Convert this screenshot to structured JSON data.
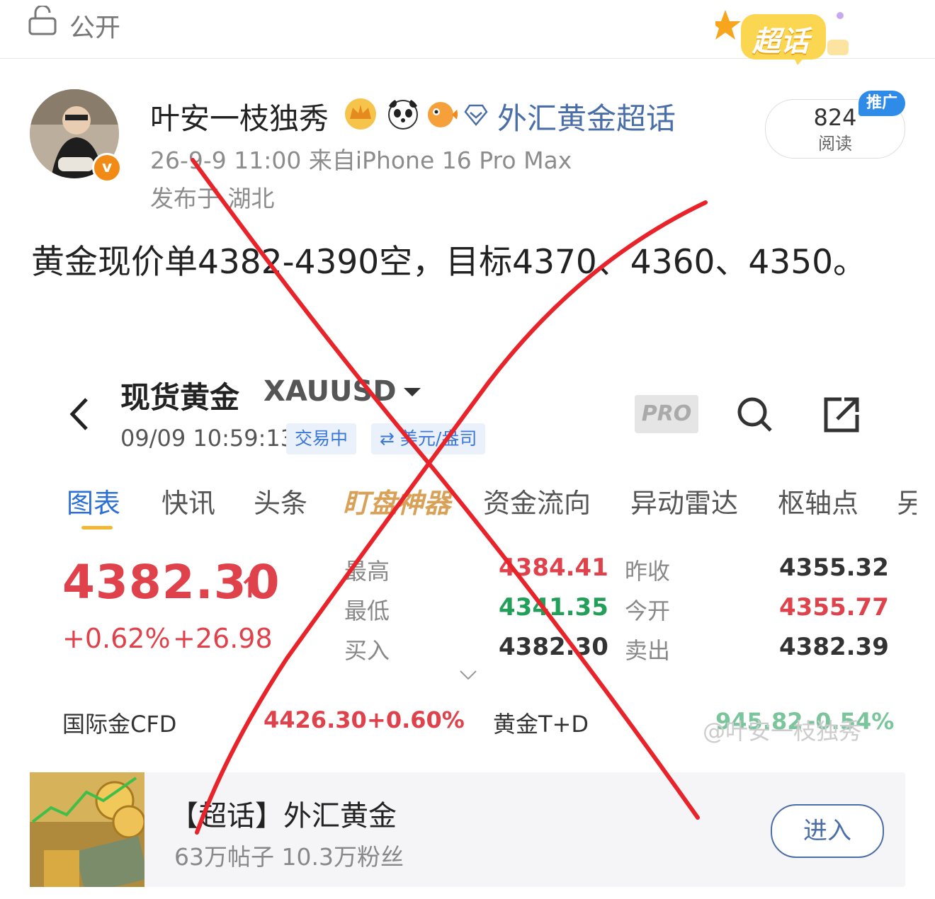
{
  "top_bar": {
    "visibility_label": "公开",
    "supertopic_badge": "超话"
  },
  "post": {
    "username": "叶安一枝独秀",
    "topic_link": "外汇黄金超话",
    "time_source": "26-9-9 11:00  来自iPhone 16 Pro Max",
    "location": "发布于 湖北",
    "verified_badge": "v",
    "reads": {
      "count": "824",
      "label": "阅读"
    },
    "promo_tag": "推广",
    "body": "黄金现价单4382-4390空，目标4370、4360、4350。"
  },
  "embedded_screenshot": {
    "instrument_name": "现货黄金",
    "instrument_code": "XAUUSD",
    "timestamp": "09/09 10:59:13",
    "tags": [
      "交易中",
      "⇄ 美元/盎司"
    ],
    "pro_label": "PRO",
    "tabs": [
      "图表",
      "快讯",
      "头条",
      "盯盘神器",
      "资金流向",
      "异动雷达",
      "枢轴点",
      "另"
    ],
    "price": "4382.30",
    "change_pct": "+0.62%",
    "change_abs": "+26.98",
    "stats": [
      {
        "label": "最高",
        "value": "4384.41"
      },
      {
        "label": "最低",
        "value": "4341.35"
      },
      {
        "label": "买入",
        "value": "4382.30"
      },
      {
        "label": "昨收",
        "value": "4355.32"
      },
      {
        "label": "今开",
        "value": "4355.77"
      },
      {
        "label": "卖出",
        "value": "4382.39"
      }
    ],
    "related": [
      {
        "name": "国际金CFD",
        "value": "4426.30",
        "change": "+0.60%"
      },
      {
        "name": "黄金T+D",
        "value": "945.82",
        "change": "-0.54%"
      }
    ],
    "watermark": "@叶安一枝独秀"
  },
  "supertopic_card": {
    "title": "【超话】外汇黄金",
    "subtitle": "63万帖子 10.3万粉丝",
    "enter_label": "进入"
  },
  "colors": {
    "link_blue": "#4a6ea8",
    "up_red": "#e0424c",
    "down_green": "#22a05a",
    "cross_red": "#e8232a"
  }
}
